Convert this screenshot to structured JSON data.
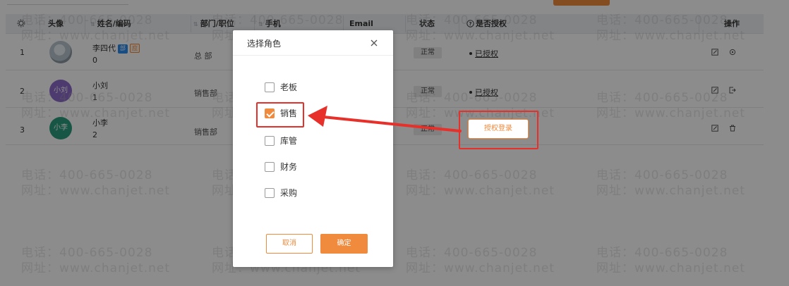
{
  "table": {
    "headers": {
      "avatar": "头像",
      "name": "姓名/编码",
      "dept": "部门/职位",
      "phone": "手机",
      "email": "Email",
      "status": "状态",
      "authorized": "是否授权",
      "ops": "操作"
    },
    "rows": [
      {
        "index": "1",
        "name": "李四代",
        "code": "0",
        "dept": "总 部",
        "status": "正常",
        "auth": "已授权",
        "badge1": "部",
        "badge2": "应"
      },
      {
        "index": "2",
        "name": "小刘",
        "code": "1",
        "dept": "销售部",
        "status": "正常",
        "auth": "已授权",
        "avatar_text": "小刘"
      },
      {
        "index": "3",
        "name": "小李",
        "code": "2",
        "dept": "销售部",
        "status": "正常",
        "auth_button": "授权登录",
        "avatar_text": "小李"
      }
    ]
  },
  "modal": {
    "title": "选择角色",
    "options": [
      {
        "label": "老板",
        "checked": false
      },
      {
        "label": "销售",
        "checked": true
      },
      {
        "label": "库管",
        "checked": false
      },
      {
        "label": "财务",
        "checked": false
      },
      {
        "label": "采购",
        "checked": false
      }
    ],
    "cancel_label": "取消",
    "ok_label": "确定"
  },
  "watermark": {
    "phone": "电话：400-665-0028",
    "site": "网址：www.chanjet.net"
  },
  "colors": {
    "accent": "#f08a3c",
    "highlight": "#e8302a",
    "avatar_purple": "#8d6bc9",
    "avatar_green": "#2a9d7f",
    "badge_blue": "#2d8cf0"
  }
}
